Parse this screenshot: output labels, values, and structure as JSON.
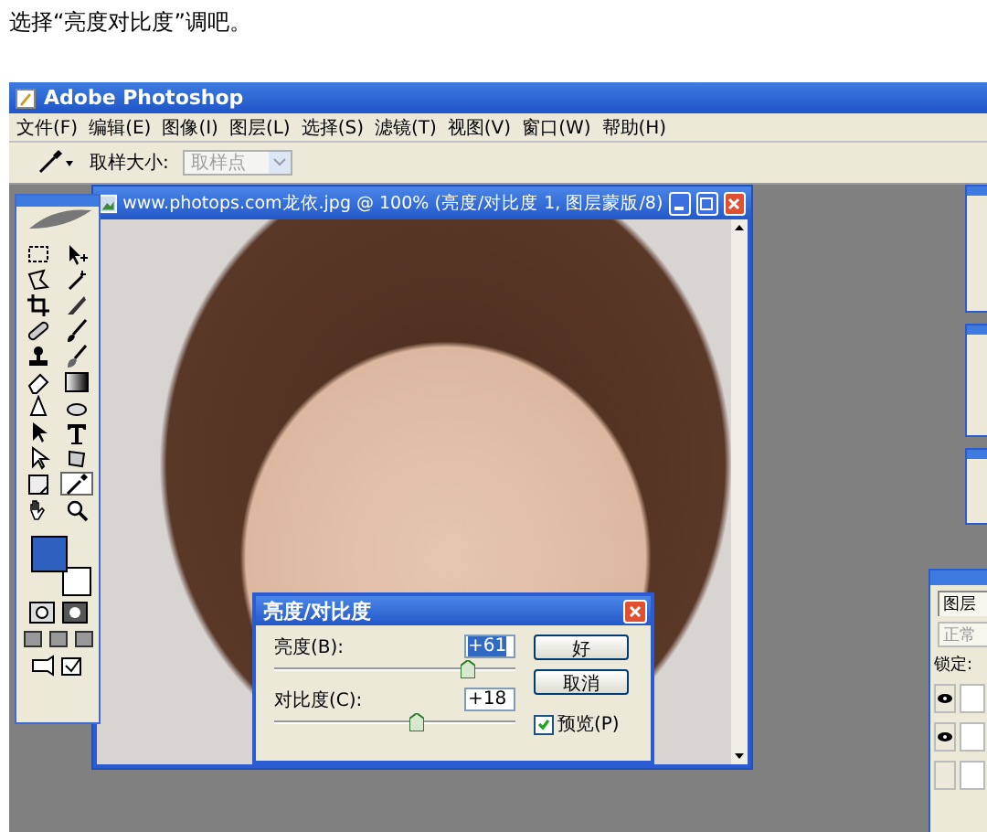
{
  "caption": "选择“亮度对比度”调吧。",
  "app": {
    "title": "Adobe Photoshop",
    "menu": [
      "文件(F)",
      "编辑(E)",
      "图像(I)",
      "图层(L)",
      "选择(S)",
      "滤镜(T)",
      "视图(V)",
      "窗口(W)",
      "帮助(H)"
    ],
    "options": {
      "label": "取样大小:",
      "dropdown": {
        "value": "取样点",
        "disabled": true
      }
    }
  },
  "toolbox": {
    "tools": [
      {
        "kind": "marquee",
        "selected": false
      },
      {
        "kind": "move",
        "selected": false
      },
      {
        "kind": "lasso",
        "selected": false
      },
      {
        "kind": "wand",
        "selected": false
      },
      {
        "kind": "crop",
        "selected": false
      },
      {
        "kind": "slice",
        "selected": false
      },
      {
        "kind": "heal",
        "selected": false
      },
      {
        "kind": "brush",
        "selected": false
      },
      {
        "kind": "stamp",
        "selected": false
      },
      {
        "kind": "history",
        "selected": false
      },
      {
        "kind": "eraser",
        "selected": false
      },
      {
        "kind": "gradient",
        "selected": false
      },
      {
        "kind": "blur",
        "selected": false
      },
      {
        "kind": "dodge",
        "selected": false
      },
      {
        "kind": "pathsel",
        "selected": false
      },
      {
        "kind": "type",
        "selected": false
      },
      {
        "kind": "pen",
        "selected": false
      },
      {
        "kind": "shape",
        "selected": false
      },
      {
        "kind": "notes",
        "selected": false
      },
      {
        "kind": "eyedropper",
        "selected": true
      },
      {
        "kind": "hand",
        "selected": false
      },
      {
        "kind": "zoom",
        "selected": false
      }
    ],
    "swatches": [
      {
        "color": "#2f5fbf"
      },
      {
        "color": "#ffffff"
      }
    ]
  },
  "document": {
    "title": "www.photops.com龙依.jpg @ 100% (亮度/对比度 1, 图层蒙版/8)"
  },
  "dialog": {
    "title": "亮度/对比度",
    "controls": [
      {
        "label": "亮度(B):",
        "value": "+61",
        "selected_text": true,
        "level": 0.8
      },
      {
        "label": "对比度(C):",
        "value": "+18",
        "selected_text": false,
        "level": 0.59
      }
    ],
    "buttons": [
      "好",
      "取消"
    ],
    "preview": {
      "label": "预览(P)",
      "checked": true
    }
  },
  "layers_panel": {
    "tab": "图层",
    "blend_mode": "正常",
    "lock_label": "锁定:",
    "layers": [
      {
        "visible": true
      },
      {
        "visible": true
      },
      {
        "visible": false
      }
    ]
  }
}
